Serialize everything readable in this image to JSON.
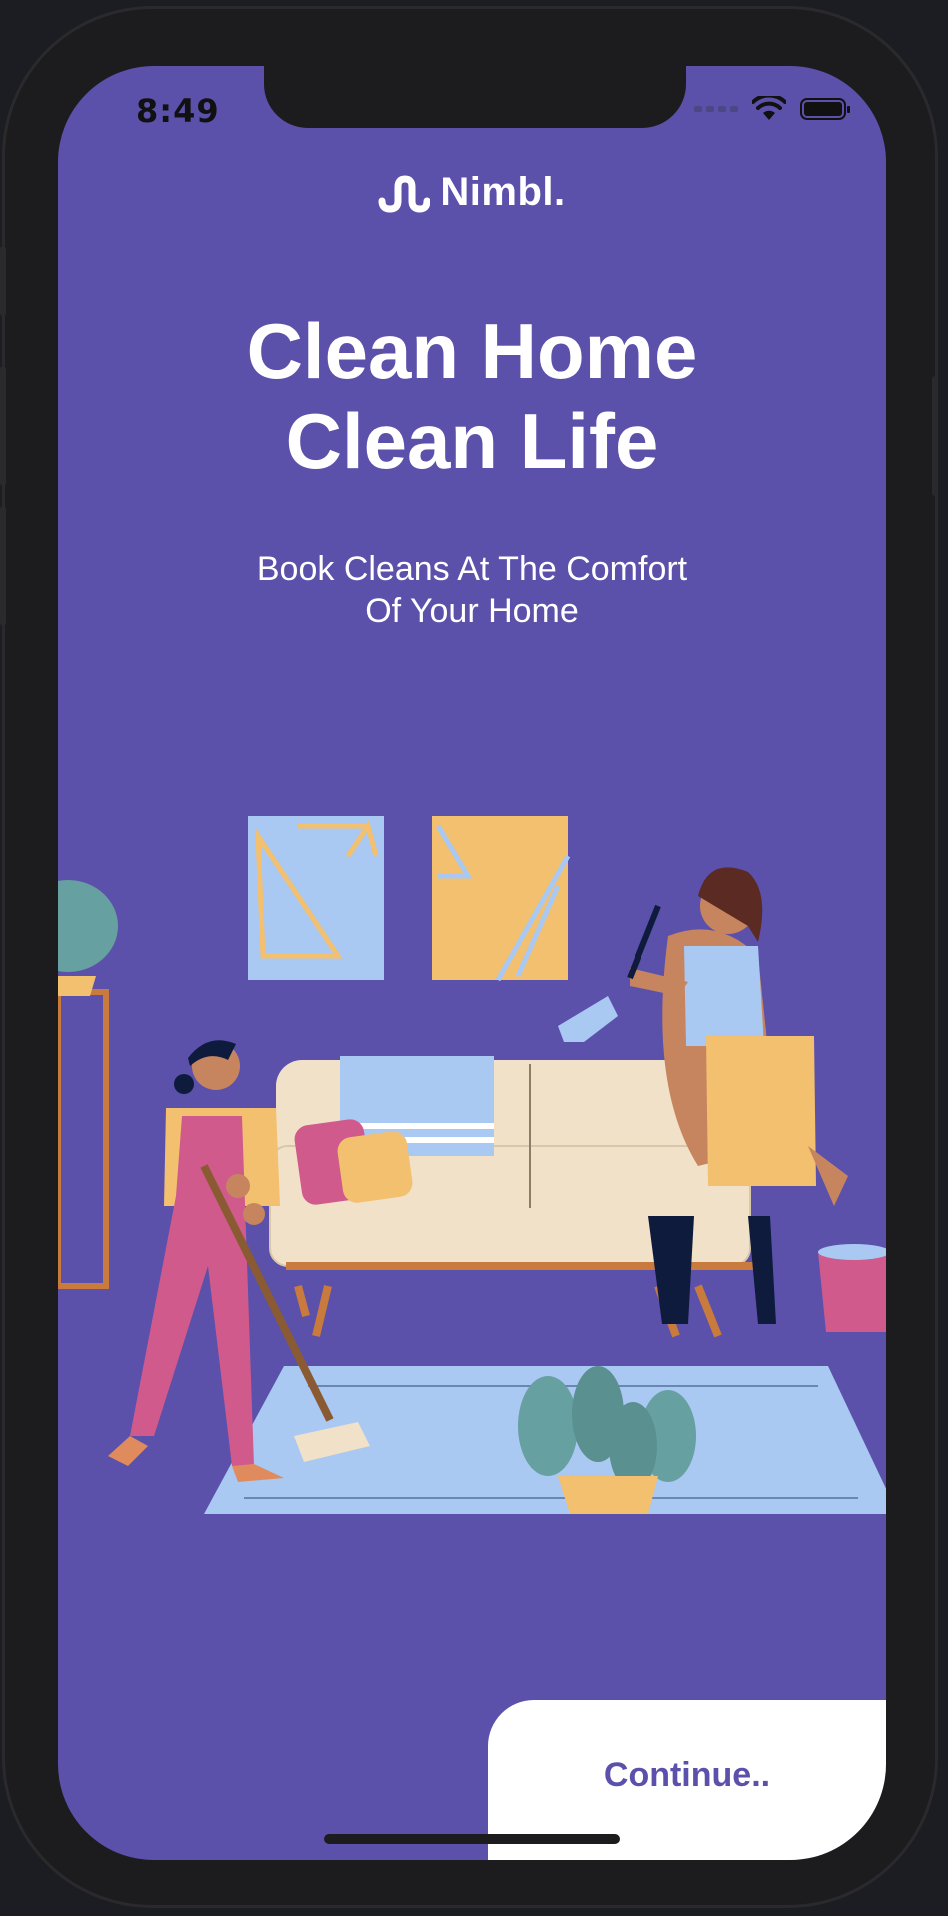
{
  "status_bar": {
    "time": "8:49",
    "icons": [
      "signal-icon",
      "wifi-icon",
      "battery-icon"
    ]
  },
  "brand": {
    "logo_icon": "nimbl-logo-icon",
    "name": "Nimbl."
  },
  "hero": {
    "title_line1": "Clean Home",
    "title_line2": "Clean Life",
    "subtitle_line1": "Book Cleans At The Comfort",
    "subtitle_line2": "Of Your Home"
  },
  "illustration": {
    "icon": "cleaning-illustration"
  },
  "cta": {
    "label": "Continue.."
  },
  "colors": {
    "background": "#5b51ab",
    "accent": "#5b51ab",
    "button_bg": "#ffffff",
    "text": "#ffffff"
  }
}
